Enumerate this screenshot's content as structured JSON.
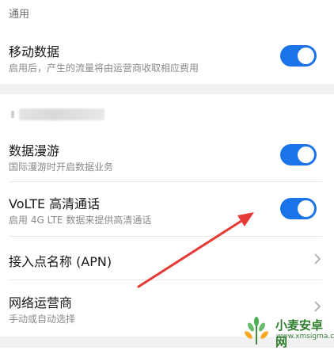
{
  "section": {
    "header": "通用"
  },
  "mobile_data": {
    "title": "移动数据",
    "subtitle": "启用后，产生的流量将由运营商收取相应费用",
    "enabled": true
  },
  "roaming": {
    "title": "数据漫游",
    "subtitle": "国际漫游时开启数据业务",
    "enabled": true
  },
  "volte": {
    "title": "VoLTE 高清通话",
    "subtitle": "启用 4G LTE 数据来提供高清通话",
    "enabled": true
  },
  "apn": {
    "title": "接入点名称 (APN)"
  },
  "carrier": {
    "title": "网络运营商",
    "subtitle": "手动或自动选择"
  },
  "watermark": {
    "name": "小麦安卓网",
    "url": "www.xmsigma.com"
  },
  "colors": {
    "toggle_on": "#1a73e8",
    "annotation_arrow": "#e53935",
    "section_band": "#f2f2f2"
  }
}
